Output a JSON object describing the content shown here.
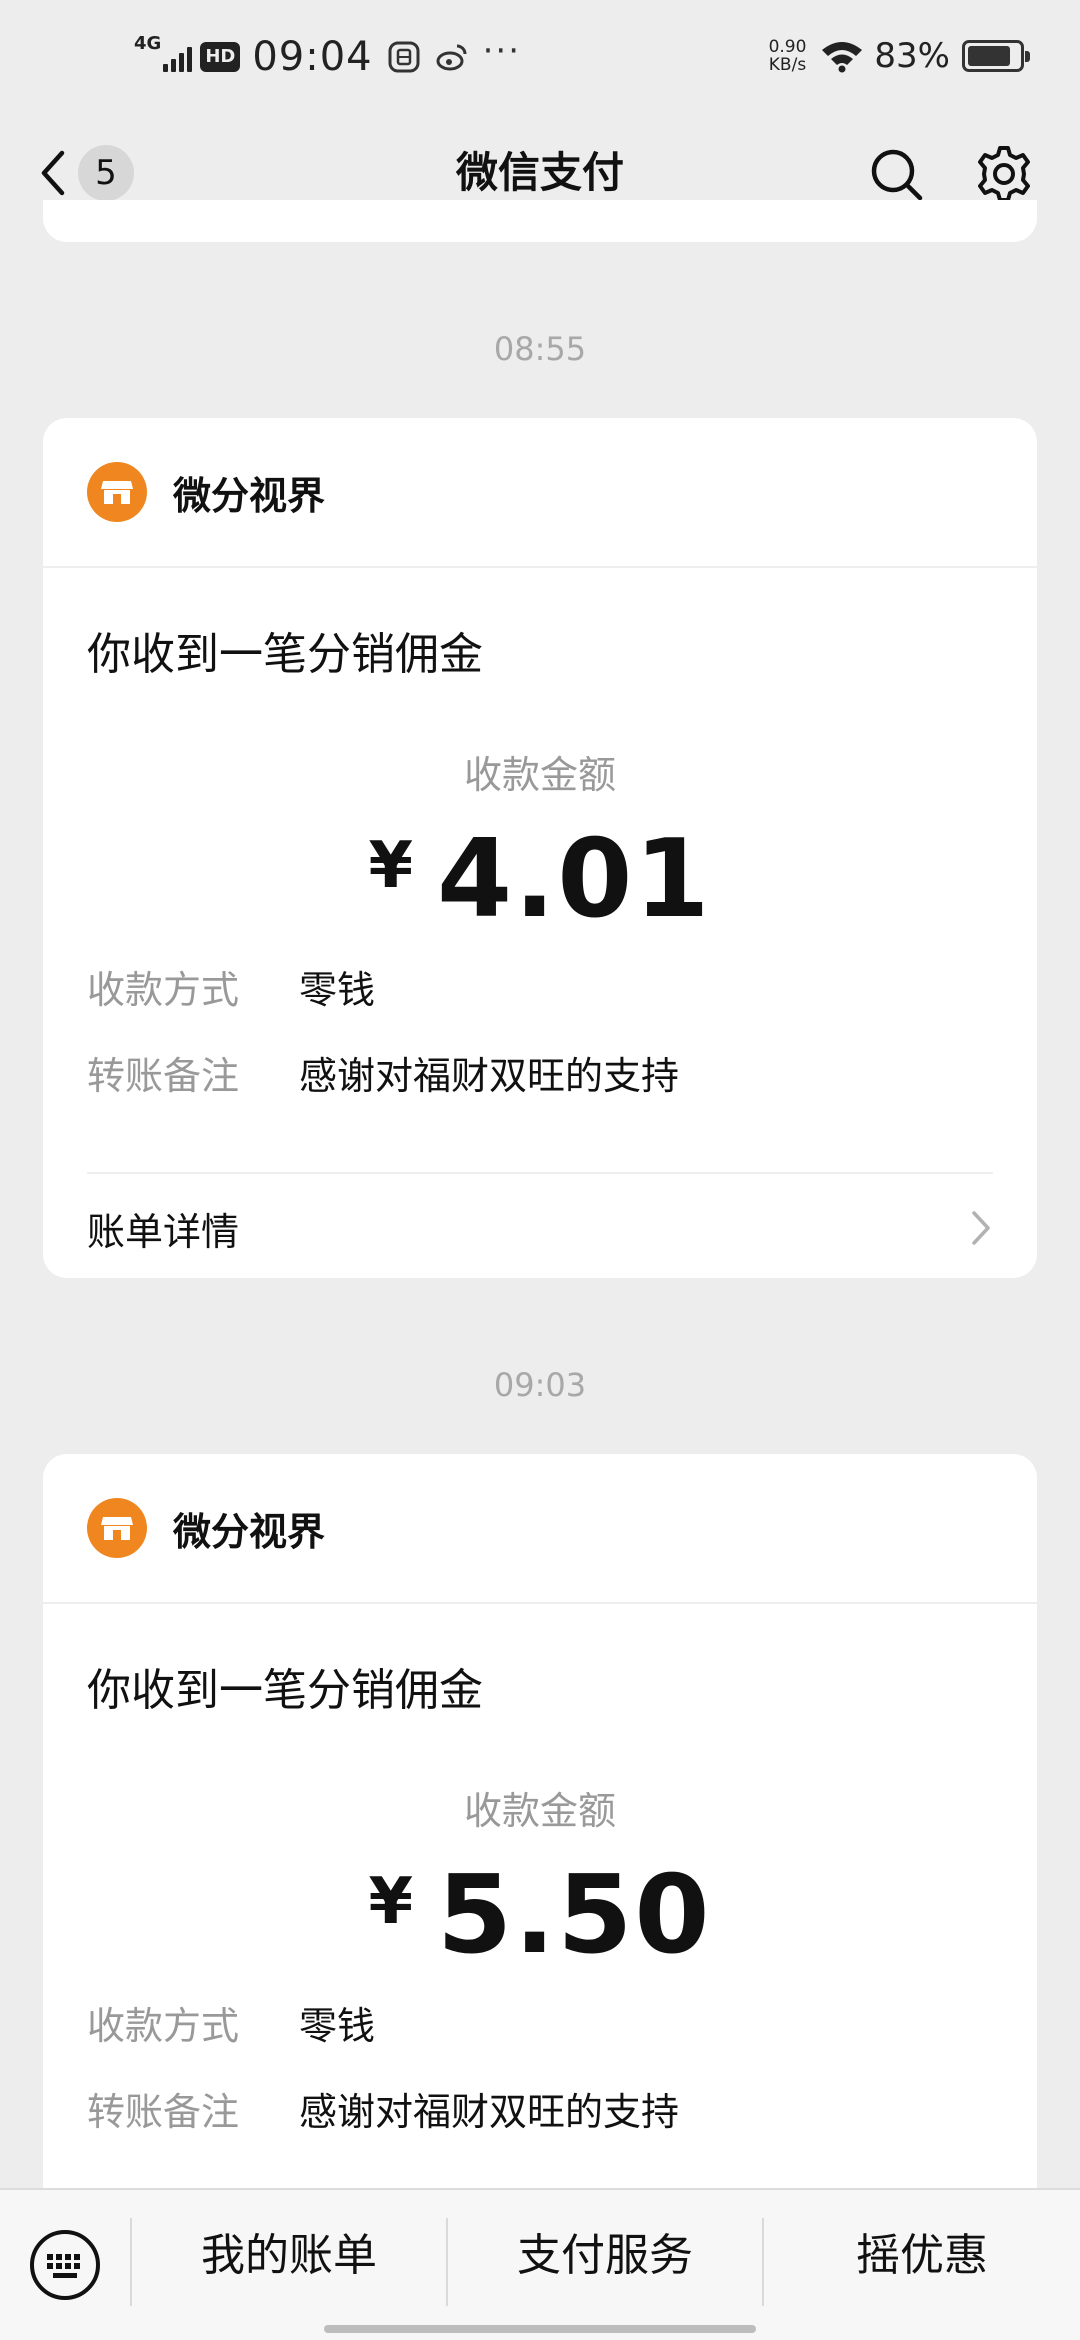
{
  "status_bar": {
    "network": "4G",
    "hd": "HD",
    "time": "09:04",
    "more": "···",
    "speed_value": "0.90",
    "speed_unit": "KB/s",
    "battery_pct": "83%",
    "battery_level": 0.83
  },
  "nav": {
    "back_count": "5",
    "title": "微信支付",
    "icons": [
      "chevron-left-icon",
      "search-icon",
      "gear-icon"
    ]
  },
  "messages": [
    {
      "time": "08:55",
      "merchant": "微分视界",
      "title": "你收到一笔分销佣金",
      "amount_label": "收款金额",
      "currency": "¥",
      "amount": "4.01",
      "method_label": "收款方式",
      "method_value": "零钱",
      "note_label": "转账备注",
      "note_value": "感谢对福财双旺的支持",
      "detail_label": "账单详情"
    },
    {
      "time": "09:03",
      "merchant": "微分视界",
      "title": "你收到一笔分销佣金",
      "amount_label": "收款金额",
      "currency": "¥",
      "amount": "5.50",
      "method_label": "收款方式",
      "method_value": "零钱",
      "note_label": "转账备注",
      "note_value": "感谢对福财双旺的支持"
    }
  ],
  "bottom_bar": {
    "items": [
      "我的账单",
      "支付服务",
      "摇优惠"
    ]
  },
  "colors": {
    "background": "#ededed",
    "card": "#ffffff",
    "merchant_icon": "#f0861f",
    "secondary_text": "#999999"
  }
}
